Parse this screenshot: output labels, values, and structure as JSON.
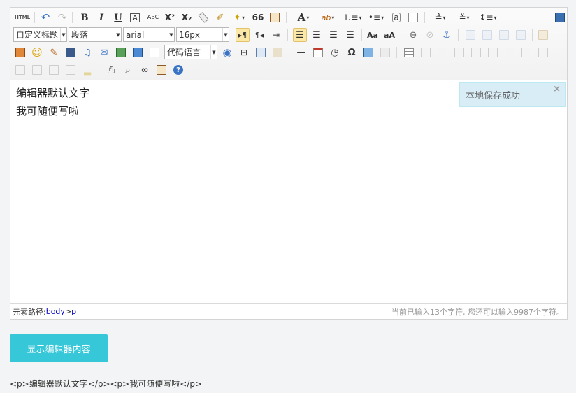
{
  "toolbar": {
    "html_label": "HTML",
    "bold": "B",
    "italic": "I",
    "underline": "U",
    "font_border": "A",
    "strike": "ABC",
    "superscript": "X²",
    "subscript": "X₂",
    "blockquote": "66",
    "fontcolor": "A",
    "customstyle": "自定义标题",
    "paragraph": "段落",
    "fontfamily": "arial",
    "fontsize": "16px",
    "insertcode": "代码语言",
    "omega": "Ω",
    "help": "?"
  },
  "editor": {
    "lines": [
      "编辑器默认文字",
      "我可随便写啦"
    ]
  },
  "toast": {
    "message": "本地保存成功",
    "close": "×"
  },
  "status": {
    "path_label": "元素路径: ",
    "path_body": "body",
    "path_sep": " > ",
    "path_p": "p",
    "count_text": "当前已输入13个字符, 您还可以输入9987个字符。"
  },
  "show_button": "显示编辑器内容",
  "output_text": "<p>编辑器默认文字</p><p>我可随便写啦</p>",
  "colors": {
    "accent": "#36c7d8",
    "toast_bg": "#d9edf7",
    "active_btn": "#fce8a6"
  }
}
